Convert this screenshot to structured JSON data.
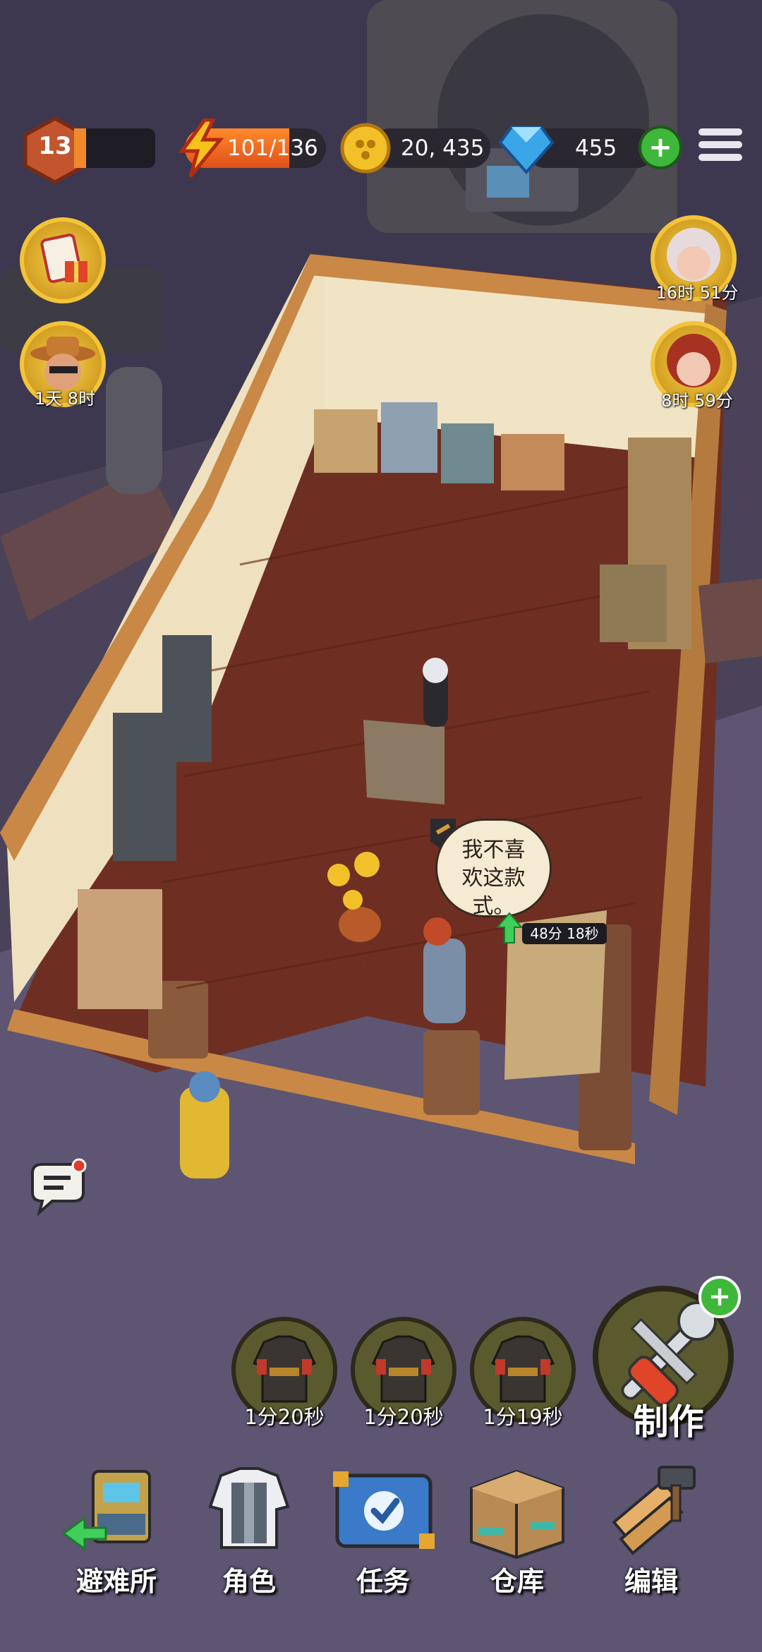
{
  "hud": {
    "level": "13",
    "xp_progress": 0.15,
    "energy": "101/136",
    "energy_progress": 0.74,
    "coins": "20, 435",
    "gems": "455",
    "add_icon": "plus",
    "menu_icon": "hamburger"
  },
  "left_side": {
    "event_icon": "gift-checklist-icon",
    "visitor_timer": "1天 8时"
  },
  "right_side": {
    "visitor1_timer": "16时 51分",
    "visitor2_timer": "8时 59分"
  },
  "scene": {
    "customer_speech": "我不喜欢这款式。",
    "speech_line1": "我不喜",
    "speech_line2": "欢这款",
    "speech_line3": "式。",
    "sale_timer": "48分 18秒"
  },
  "crafting_queue": [
    {
      "item_icon": "jacket-icon",
      "timer": "1分20秒"
    },
    {
      "item_icon": "jacket-icon",
      "timer": "1分20秒"
    },
    {
      "item_icon": "jacket-icon",
      "timer": "1分19秒"
    }
  ],
  "craft_button": {
    "label": "制作",
    "icon": "wrench-screwdriver-icon"
  },
  "bottom_nav": [
    {
      "label": "避难所",
      "icon": "shelter-icon"
    },
    {
      "label": "角色",
      "icon": "vest-icon"
    },
    {
      "label": "任务",
      "icon": "task-check-icon"
    },
    {
      "label": "仓库",
      "icon": "crate-icon"
    },
    {
      "label": "编辑",
      "icon": "hammer-wood-icon"
    }
  ],
  "colors": {
    "accent_green": "#3fb73a",
    "energy_orange": "#f08a2a",
    "floor_brown": "#6e2f22",
    "wall_cream": "#f0e4c4"
  }
}
